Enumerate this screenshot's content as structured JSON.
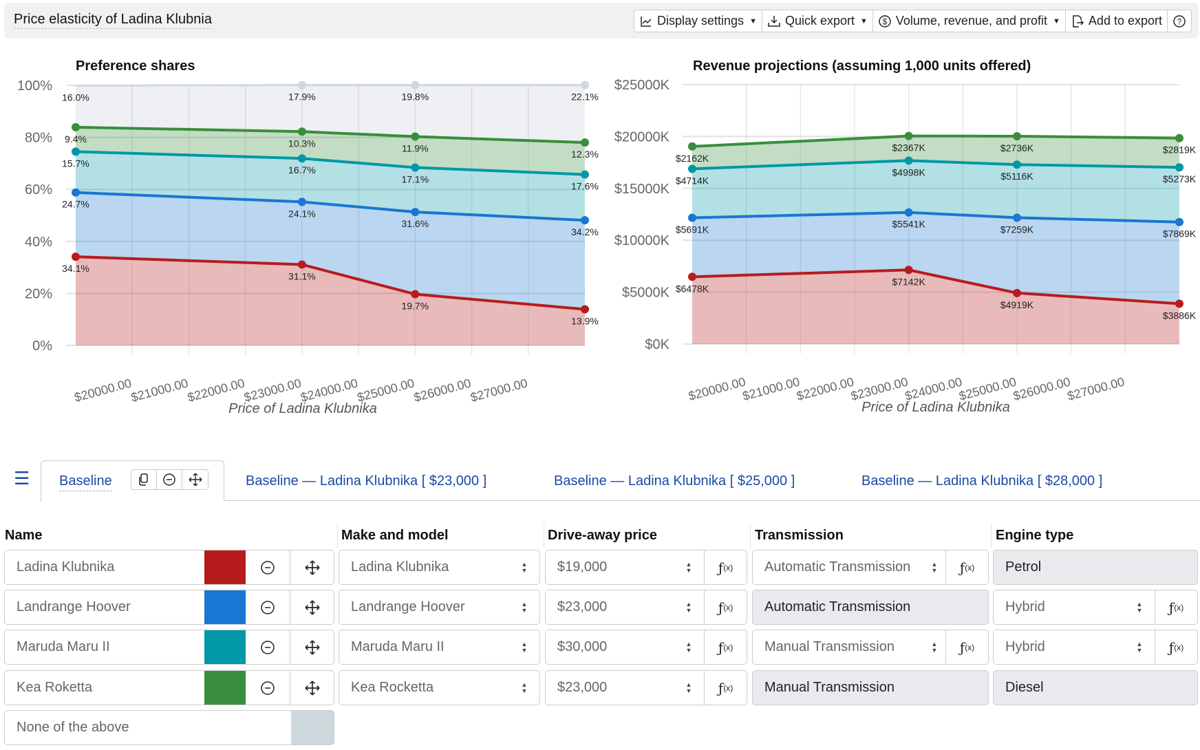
{
  "header": {
    "title": "Price elasticity of Ladina Klubnia",
    "toolbar": [
      {
        "label": "Display settings",
        "icon": "line-chart-icon",
        "dropdown": true
      },
      {
        "label": "Quick export",
        "icon": "download-tray-icon",
        "dropdown": true
      },
      {
        "label": "Volume, revenue, and profit",
        "icon": "dollar-circle-icon",
        "dropdown": true
      },
      {
        "label": "Add to export",
        "icon": "file-export-icon",
        "dropdown": false
      },
      {
        "label": "",
        "icon": "help-circle-icon",
        "dropdown": false
      }
    ]
  },
  "colors": {
    "ladina": "#b71c1c",
    "landrange": "#1976d2",
    "maruda": "#0097a7",
    "kea": "#388e3c",
    "none": "#cfd8dc",
    "link": "#1a49a8"
  },
  "chart_data": [
    {
      "type": "area",
      "stacked": true,
      "title": "Preference shares",
      "xlabel": "Price of Ladina Klubnika",
      "ylabel": "",
      "x": [
        19000,
        23000,
        25000,
        28000
      ],
      "xticks": [
        "$20000.00",
        "$21000.00",
        "$22000.00",
        "$23000.00",
        "$24000.00",
        "$25000.00",
        "$26000.00",
        "$27000.00"
      ],
      "xtick_values": [
        20000,
        21000,
        22000,
        23000,
        24000,
        25000,
        26000,
        27000
      ],
      "xlim": [
        19000,
        28000
      ],
      "ylim": [
        0,
        100
      ],
      "yticks": [
        "0%",
        "20%",
        "40%",
        "60%",
        "80%",
        "100%"
      ],
      "ytick_values": [
        0,
        20,
        40,
        60,
        80,
        100
      ],
      "grid": true,
      "series": [
        {
          "name": "Ladina Klubnika",
          "color": "#b71c1c",
          "values": [
            34.1,
            31.1,
            19.7,
            13.9
          ],
          "labels": [
            "34.1%",
            "31.1%",
            "19.7%",
            "13.9%"
          ]
        },
        {
          "name": "Landrange Hoover",
          "color": "#1976d2",
          "values": [
            24.7,
            24.1,
            31.6,
            34.2
          ],
          "labels": [
            "24.7%",
            "24.1%",
            "31.6%",
            "34.2%"
          ]
        },
        {
          "name": "Maruda Maru II",
          "color": "#0097a7",
          "values": [
            15.7,
            16.7,
            17.1,
            17.6
          ],
          "labels": [
            "15.7%",
            "16.7%",
            "17.1%",
            "17.6%"
          ]
        },
        {
          "name": "Kea Roketta",
          "color": "#388e3c",
          "values": [
            9.4,
            10.3,
            11.9,
            12.3
          ],
          "labels": [
            "9.4%",
            "10.3%",
            "11.9%",
            "12.3%"
          ]
        },
        {
          "name": "None of the above",
          "color": "#cfd8dc",
          "values": [
            16.0,
            17.9,
            19.8,
            22.1
          ],
          "labels": [
            "16.0%",
            "17.9%",
            "19.8%",
            "22.1%"
          ]
        }
      ]
    },
    {
      "type": "area",
      "stacked": true,
      "title": "Revenue projections (assuming 1,000 units offered)",
      "xlabel": "Price of Ladina Klubnika",
      "ylabel": "",
      "x": [
        19000,
        23000,
        25000,
        28000
      ],
      "xticks": [
        "$20000.00",
        "$21000.00",
        "$22000.00",
        "$23000.00",
        "$24000.00",
        "$25000.00",
        "$26000.00",
        "$27000.00"
      ],
      "xtick_values": [
        20000,
        21000,
        22000,
        23000,
        24000,
        25000,
        26000,
        27000
      ],
      "xlim": [
        19000,
        28000
      ],
      "ylim": [
        0,
        25000
      ],
      "yticks": [
        "$0K",
        "$5000K",
        "$10000K",
        "$15000K",
        "$20000K",
        "$25000K"
      ],
      "ytick_values": [
        0,
        5000,
        10000,
        15000,
        20000,
        25000
      ],
      "grid": true,
      "series": [
        {
          "name": "Ladina Klubnika",
          "color": "#b71c1c",
          "values": [
            6478,
            7142,
            4919,
            3886
          ],
          "labels": [
            "$6478K",
            "$7142K",
            "$4919K",
            "$3886K"
          ]
        },
        {
          "name": "Landrange Hoover",
          "color": "#1976d2",
          "values": [
            5691,
            5541,
            7259,
            7869
          ],
          "labels": [
            "$5691K",
            "$5541K",
            "$7259K",
            "$7869K"
          ]
        },
        {
          "name": "Maruda Maru II",
          "color": "#0097a7",
          "values": [
            4714,
            4998,
            5116,
            5273
          ],
          "labels": [
            "$4714K",
            "$4998K",
            "$5116K",
            "$5273K"
          ]
        },
        {
          "name": "Kea Roketta",
          "color": "#388e3c",
          "values": [
            2162,
            2367,
            2736,
            2819
          ],
          "labels": [
            "$2162K",
            "$2367K",
            "$2736K",
            "$2819K"
          ]
        }
      ]
    }
  ],
  "tabs": {
    "active": "Baseline",
    "others": [
      "Baseline — Ladina Klubnika [ $23,000 ]",
      "Baseline — Ladina Klubnika [ $25,000 ]",
      "Baseline — Ladina Klubnika [ $28,000 ]"
    ]
  },
  "table": {
    "headers": [
      "Name",
      "Make and model",
      "Drive-away price",
      "Transmission",
      "Engine type"
    ],
    "rows": [
      {
        "name": "Ladina Klubnika",
        "color": "#b71c1c",
        "make": "Ladina Klubnika",
        "price": "$19,000",
        "transmission": "Automatic Transmission",
        "transmission_editable": true,
        "engine": "Petrol",
        "engine_editable": false
      },
      {
        "name": "Landrange Hoover",
        "color": "#1976d2",
        "make": "Landrange Hoover",
        "price": "$23,000",
        "transmission": "Automatic Transmission",
        "transmission_editable": false,
        "engine": "Hybrid",
        "engine_editable": true
      },
      {
        "name": "Maruda Maru II",
        "color": "#0097a7",
        "make": "Maruda Maru II",
        "price": "$30,000",
        "transmission": "Manual Transmission",
        "transmission_editable": true,
        "engine": "Hybrid",
        "engine_editable": true
      },
      {
        "name": "Kea Roketta",
        "color": "#388e3c",
        "make": "Kea Rocketta",
        "price": "$23,000",
        "transmission": "Manual Transmission",
        "transmission_editable": false,
        "engine": "Diesel",
        "engine_editable": false
      }
    ],
    "none_row": {
      "name": "None of the above",
      "color": "#cfd8dc"
    }
  }
}
